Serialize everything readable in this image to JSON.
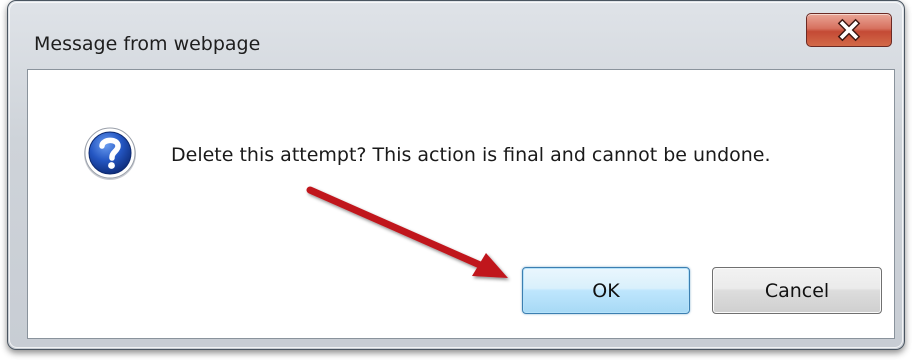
{
  "dialog": {
    "title": "Message from webpage",
    "message": "Delete this attempt? This action is final and cannot be undone.",
    "icon": "question-icon",
    "buttons": {
      "ok_label": "OK",
      "cancel_label": "Cancel"
    },
    "close_icon": "close-icon"
  },
  "annotation": {
    "arrow_color": "#c0141c",
    "target": "ok-button"
  },
  "colors": {
    "close_button": "#c9503a",
    "ok_button_border": "#3c7fb1",
    "icon_blue": "#1e4fb0"
  }
}
